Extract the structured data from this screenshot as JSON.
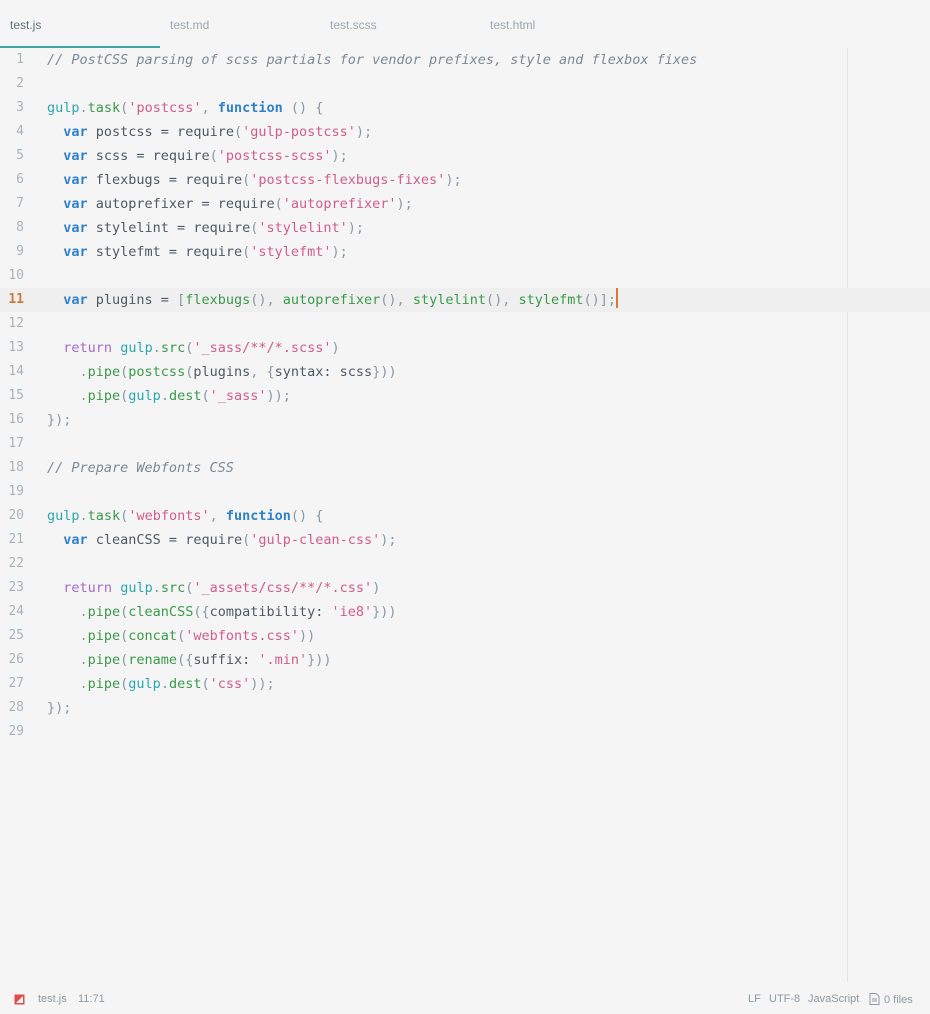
{
  "tabs": [
    {
      "label": "test.js",
      "active": true
    },
    {
      "label": "test.md",
      "active": false
    },
    {
      "label": "test.scss",
      "active": false
    },
    {
      "label": "test.html",
      "active": false
    }
  ],
  "editor": {
    "cursor_line": 11,
    "lines": [
      {
        "n": "1",
        "tokens": [
          {
            "t": "// PostCSS parsing of scss partials for vendor prefixes, style and flexbox fixes",
            "c": "com"
          }
        ]
      },
      {
        "n": "2",
        "tokens": []
      },
      {
        "n": "3",
        "tokens": [
          {
            "t": "gulp",
            "c": "obj"
          },
          {
            "t": ".",
            "c": "pun"
          },
          {
            "t": "task",
            "c": "fn"
          },
          {
            "t": "(",
            "c": "pun"
          },
          {
            "t": "'postcss'",
            "c": "str"
          },
          {
            "t": ", ",
            "c": "pun"
          },
          {
            "t": "function",
            "c": "kw"
          },
          {
            "t": " () {",
            "c": "pun"
          }
        ]
      },
      {
        "n": "4",
        "tokens": [
          {
            "t": "  ",
            "c": ""
          },
          {
            "t": "var",
            "c": "kw"
          },
          {
            "t": " postcss = require",
            "c": ""
          },
          {
            "t": "(",
            "c": "pun"
          },
          {
            "t": "'gulp-postcss'",
            "c": "str"
          },
          {
            "t": ");",
            "c": "pun"
          }
        ]
      },
      {
        "n": "5",
        "tokens": [
          {
            "t": "  ",
            "c": ""
          },
          {
            "t": "var",
            "c": "kw"
          },
          {
            "t": " scss = require",
            "c": ""
          },
          {
            "t": "(",
            "c": "pun"
          },
          {
            "t": "'postcss-scss'",
            "c": "str"
          },
          {
            "t": ");",
            "c": "pun"
          }
        ]
      },
      {
        "n": "6",
        "tokens": [
          {
            "t": "  ",
            "c": ""
          },
          {
            "t": "var",
            "c": "kw"
          },
          {
            "t": " flexbugs = require",
            "c": ""
          },
          {
            "t": "(",
            "c": "pun"
          },
          {
            "t": "'postcss-flexbugs-fixes'",
            "c": "str"
          },
          {
            "t": ");",
            "c": "pun"
          }
        ]
      },
      {
        "n": "7",
        "tokens": [
          {
            "t": "  ",
            "c": ""
          },
          {
            "t": "var",
            "c": "kw"
          },
          {
            "t": " autoprefixer = require",
            "c": ""
          },
          {
            "t": "(",
            "c": "pun"
          },
          {
            "t": "'autoprefixer'",
            "c": "str"
          },
          {
            "t": ");",
            "c": "pun"
          }
        ]
      },
      {
        "n": "8",
        "tokens": [
          {
            "t": "  ",
            "c": ""
          },
          {
            "t": "var",
            "c": "kw"
          },
          {
            "t": " stylelint = require",
            "c": ""
          },
          {
            "t": "(",
            "c": "pun"
          },
          {
            "t": "'stylelint'",
            "c": "str"
          },
          {
            "t": ");",
            "c": "pun"
          }
        ]
      },
      {
        "n": "9",
        "tokens": [
          {
            "t": "  ",
            "c": ""
          },
          {
            "t": "var",
            "c": "kw"
          },
          {
            "t": " stylefmt = require",
            "c": ""
          },
          {
            "t": "(",
            "c": "pun"
          },
          {
            "t": "'stylefmt'",
            "c": "str"
          },
          {
            "t": ");",
            "c": "pun"
          }
        ]
      },
      {
        "n": "10",
        "tokens": []
      },
      {
        "n": "11",
        "tokens": [
          {
            "t": "  ",
            "c": ""
          },
          {
            "t": "var",
            "c": "kw"
          },
          {
            "t": " plugins = ",
            "c": ""
          },
          {
            "t": "[",
            "c": "pun"
          },
          {
            "t": "flexbugs",
            "c": "fn"
          },
          {
            "t": "(), ",
            "c": "pun"
          },
          {
            "t": "autoprefixer",
            "c": "fn"
          },
          {
            "t": "(), ",
            "c": "pun"
          },
          {
            "t": "stylelint",
            "c": "fn"
          },
          {
            "t": "(), ",
            "c": "pun"
          },
          {
            "t": "stylefmt",
            "c": "fn"
          },
          {
            "t": "()];",
            "c": "pun"
          }
        ]
      },
      {
        "n": "12",
        "tokens": []
      },
      {
        "n": "13",
        "tokens": [
          {
            "t": "  ",
            "c": ""
          },
          {
            "t": "return",
            "c": "ret"
          },
          {
            "t": " ",
            "c": ""
          },
          {
            "t": "gulp",
            "c": "obj"
          },
          {
            "t": ".",
            "c": "pun"
          },
          {
            "t": "src",
            "c": "fn"
          },
          {
            "t": "(",
            "c": "pun"
          },
          {
            "t": "'_sass/**/*.scss'",
            "c": "str"
          },
          {
            "t": ")",
            "c": "pun"
          }
        ]
      },
      {
        "n": "14",
        "tokens": [
          {
            "t": "    .",
            "c": "pun"
          },
          {
            "t": "pipe",
            "c": "fn"
          },
          {
            "t": "(",
            "c": "pun"
          },
          {
            "t": "postcss",
            "c": "fn"
          },
          {
            "t": "(",
            "c": "pun"
          },
          {
            "t": "plugins",
            "c": ""
          },
          {
            "t": ", {",
            "c": "pun"
          },
          {
            "t": "syntax: scss",
            "c": ""
          },
          {
            "t": "}))",
            "c": "pun"
          }
        ]
      },
      {
        "n": "15",
        "tokens": [
          {
            "t": "    .",
            "c": "pun"
          },
          {
            "t": "pipe",
            "c": "fn"
          },
          {
            "t": "(",
            "c": "pun"
          },
          {
            "t": "gulp",
            "c": "obj"
          },
          {
            "t": ".",
            "c": "pun"
          },
          {
            "t": "dest",
            "c": "fn"
          },
          {
            "t": "(",
            "c": "pun"
          },
          {
            "t": "'_sass'",
            "c": "str"
          },
          {
            "t": "));",
            "c": "pun"
          }
        ]
      },
      {
        "n": "16",
        "tokens": [
          {
            "t": "});",
            "c": "pun"
          }
        ]
      },
      {
        "n": "17",
        "tokens": []
      },
      {
        "n": "18",
        "tokens": [
          {
            "t": "// Prepare Webfonts CSS",
            "c": "com"
          }
        ]
      },
      {
        "n": "19",
        "tokens": []
      },
      {
        "n": "20",
        "tokens": [
          {
            "t": "gulp",
            "c": "obj"
          },
          {
            "t": ".",
            "c": "pun"
          },
          {
            "t": "task",
            "c": "fn"
          },
          {
            "t": "(",
            "c": "pun"
          },
          {
            "t": "'webfonts'",
            "c": "str"
          },
          {
            "t": ", ",
            "c": "pun"
          },
          {
            "t": "function",
            "c": "kw"
          },
          {
            "t": "() {",
            "c": "pun"
          }
        ]
      },
      {
        "n": "21",
        "tokens": [
          {
            "t": "  ",
            "c": ""
          },
          {
            "t": "var",
            "c": "kw"
          },
          {
            "t": " cleanCSS = require",
            "c": ""
          },
          {
            "t": "(",
            "c": "pun"
          },
          {
            "t": "'gulp-clean-css'",
            "c": "str"
          },
          {
            "t": ");",
            "c": "pun"
          }
        ]
      },
      {
        "n": "22",
        "tokens": []
      },
      {
        "n": "23",
        "tokens": [
          {
            "t": "  ",
            "c": ""
          },
          {
            "t": "return",
            "c": "ret"
          },
          {
            "t": " ",
            "c": ""
          },
          {
            "t": "gulp",
            "c": "obj"
          },
          {
            "t": ".",
            "c": "pun"
          },
          {
            "t": "src",
            "c": "fn"
          },
          {
            "t": "(",
            "c": "pun"
          },
          {
            "t": "'_assets/css/**/*.css'",
            "c": "str"
          },
          {
            "t": ")",
            "c": "pun"
          }
        ]
      },
      {
        "n": "24",
        "tokens": [
          {
            "t": "    .",
            "c": "pun"
          },
          {
            "t": "pipe",
            "c": "fn"
          },
          {
            "t": "(",
            "c": "pun"
          },
          {
            "t": "cleanCSS",
            "c": "fn"
          },
          {
            "t": "({",
            "c": "pun"
          },
          {
            "t": "compatibility: ",
            "c": ""
          },
          {
            "t": "'ie8'",
            "c": "str"
          },
          {
            "t": "}))",
            "c": "pun"
          }
        ]
      },
      {
        "n": "25",
        "tokens": [
          {
            "t": "    .",
            "c": "pun"
          },
          {
            "t": "pipe",
            "c": "fn"
          },
          {
            "t": "(",
            "c": "pun"
          },
          {
            "t": "concat",
            "c": "fn"
          },
          {
            "t": "(",
            "c": "pun"
          },
          {
            "t": "'webfonts.css'",
            "c": "str"
          },
          {
            "t": "))",
            "c": "pun"
          }
        ]
      },
      {
        "n": "26",
        "tokens": [
          {
            "t": "    .",
            "c": "pun"
          },
          {
            "t": "pipe",
            "c": "fn"
          },
          {
            "t": "(",
            "c": "pun"
          },
          {
            "t": "rename",
            "c": "fn"
          },
          {
            "t": "({",
            "c": "pun"
          },
          {
            "t": "suffix: ",
            "c": ""
          },
          {
            "t": "'.min'",
            "c": "str"
          },
          {
            "t": "}))",
            "c": "pun"
          }
        ]
      },
      {
        "n": "27",
        "tokens": [
          {
            "t": "    .",
            "c": "pun"
          },
          {
            "t": "pipe",
            "c": "fn"
          },
          {
            "t": "(",
            "c": "pun"
          },
          {
            "t": "gulp",
            "c": "obj"
          },
          {
            "t": ".",
            "c": "pun"
          },
          {
            "t": "dest",
            "c": "fn"
          },
          {
            "t": "(",
            "c": "pun"
          },
          {
            "t": "'css'",
            "c": "str"
          },
          {
            "t": "));",
            "c": "pun"
          }
        ]
      },
      {
        "n": "28",
        "tokens": [
          {
            "t": "});",
            "c": "pun"
          }
        ]
      },
      {
        "n": "29",
        "tokens": []
      }
    ]
  },
  "status": {
    "status_icon": "flag-icon",
    "file": "test.js",
    "position": "11:71",
    "line_ending": "LF",
    "encoding": "UTF-8",
    "grammar": "JavaScript",
    "files_icon": "file-icon",
    "files": "0 files"
  }
}
